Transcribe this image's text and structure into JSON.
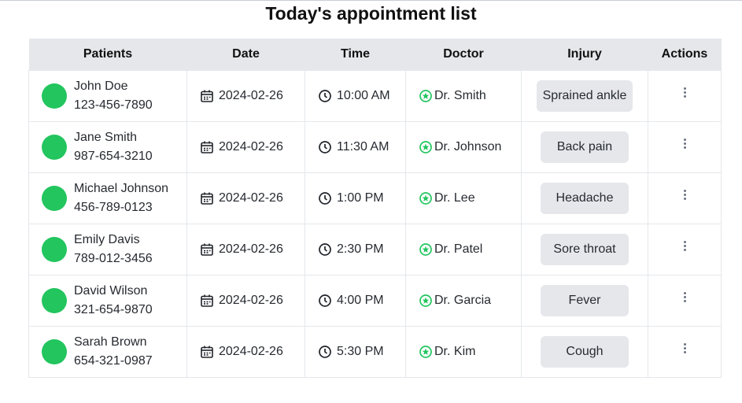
{
  "title": "Today's appointment list",
  "columns": [
    "Patients",
    "Date",
    "Time",
    "Doctor",
    "Injury",
    "Actions"
  ],
  "appointments": [
    {
      "name": "John Doe",
      "phone": "123-456-7890",
      "date": "2024-02-26",
      "time": "10:00 AM",
      "doctor": "Dr. Smith",
      "injury": "Sprained ankle"
    },
    {
      "name": "Jane Smith",
      "phone": "987-654-3210",
      "date": "2024-02-26",
      "time": "11:30 AM",
      "doctor": "Dr. Johnson",
      "injury": "Back pain"
    },
    {
      "name": "Michael Johnson",
      "phone": "456-789-0123",
      "date": "2024-02-26",
      "time": "1:00 PM",
      "doctor": "Dr. Lee",
      "injury": "Headache"
    },
    {
      "name": "Emily Davis",
      "phone": "789-012-3456",
      "date": "2024-02-26",
      "time": "2:30 PM",
      "doctor": "Dr. Patel",
      "injury": "Sore throat"
    },
    {
      "name": "David Wilson",
      "phone": "321-654-9870",
      "date": "2024-02-26",
      "time": "4:00 PM",
      "doctor": "Dr. Garcia",
      "injury": "Fever"
    },
    {
      "name": "Sarah Brown",
      "phone": "654-321-0987",
      "date": "2024-02-26",
      "time": "5:30 PM",
      "doctor": "Dr. Kim",
      "injury": "Cough"
    }
  ],
  "icons": {
    "avatar": "avatar-circle",
    "date": "calendar-icon",
    "time": "clock-icon",
    "doctor": "doctor-badge-icon",
    "actions": "more-vertical-icon"
  },
  "colors": {
    "avatar": "#22c55e",
    "doctor_icon": "#22c55e",
    "header_bg": "#e5e7eb",
    "badge_bg": "#e5e7eb"
  }
}
